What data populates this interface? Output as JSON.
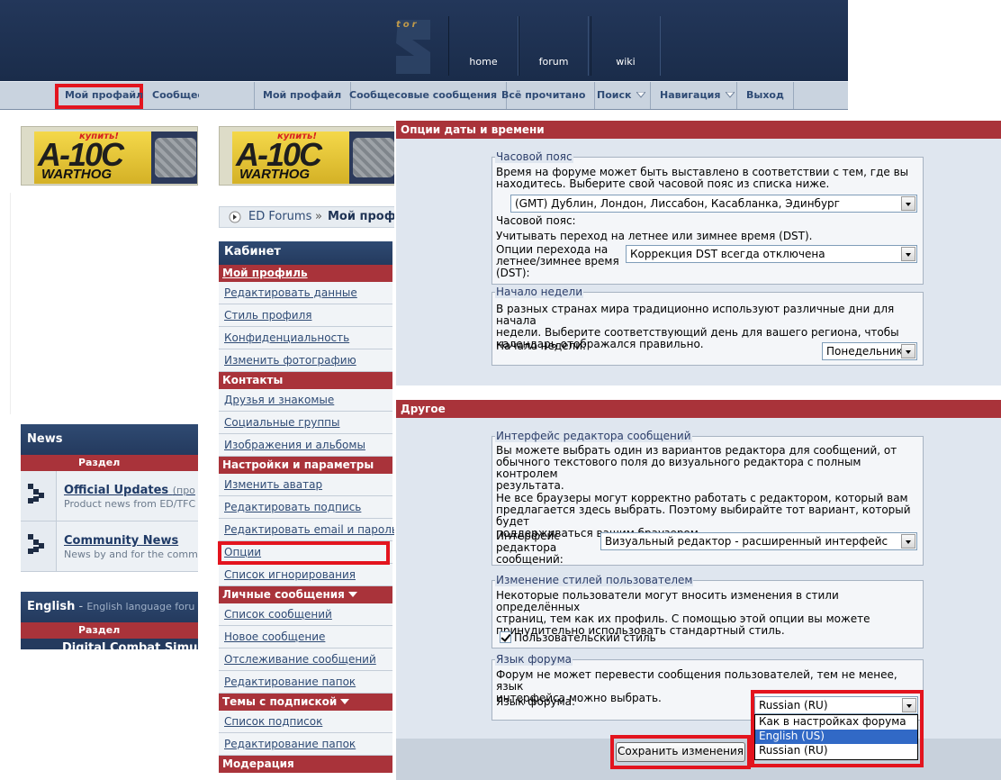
{
  "header": {
    "logo_letters": "tor",
    "tabs": [
      "home",
      "forum",
      "wiki"
    ]
  },
  "navbar_left": {
    "my_profile": "Мой профайл",
    "community": "Сообщес"
  },
  "navbar": {
    "items": [
      "Мой профайл",
      "Сообщесовые сообщения",
      "Всё прочитано",
      "Поиск",
      "Навигация",
      "Выход"
    ]
  },
  "banner": {
    "kupit": "купить!",
    "title": "A-10C",
    "subtitle": "WARTHOG"
  },
  "breadcrumb": {
    "home": "ED Forums",
    "sep": "»",
    "current": "Мой проф"
  },
  "left": {
    "news_header": "News",
    "section_label": "Раздел",
    "forums": [
      {
        "title": "Official Updates",
        "suffix": "(про",
        "desc": "Product news from ED/TFC"
      },
      {
        "title": "Community News",
        "suffix": "",
        "desc": "News by and for the comm"
      }
    ],
    "english_header": "English",
    "english_sep": " - ",
    "english_desc": "English language foru",
    "section_label2": "Раздел",
    "next_forum": "Digital Combat Simul"
  },
  "cabinet": {
    "title": "Кабинет",
    "sections": [
      {
        "title": "Мой профиль",
        "underline": true,
        "dropdown": false,
        "links": [
          "Редактировать данные",
          "Стиль профиля",
          "Конфиденциальность",
          "Изменить фотографию"
        ]
      },
      {
        "title": "Контакты",
        "underline": false,
        "dropdown": false,
        "links": [
          "Друзья и знакомые",
          "Социальные группы",
          "Изображения и альбомы"
        ]
      },
      {
        "title": "Настройки и параметры",
        "underline": false,
        "dropdown": false,
        "links": [
          "Изменить аватар",
          "Редактировать подпись",
          "Редактировать email и пароль",
          "Опции",
          "Список игнорирования"
        ]
      },
      {
        "title": "Личные сообщения",
        "underline": false,
        "dropdown": true,
        "links": [
          "Список сообщений",
          "Новое сообщение",
          "Отслеживание сообщений",
          "Редактирование папок"
        ]
      },
      {
        "title": "Темы с подпиской",
        "underline": false,
        "dropdown": true,
        "links": [
          "Список подписок",
          "Редактирование папок"
        ]
      },
      {
        "title": "Модерация",
        "underline": false,
        "dropdown": false,
        "links": []
      }
    ]
  },
  "datetime": {
    "header": "Опции даты и времени",
    "timezone": {
      "legend": "Часовой пояс",
      "desc1": "Время на форуме может быть выставлено в соответствии с тем, где вы",
      "desc2": "находитесь. Выберите свой часовой пояс из списка ниже.",
      "select_value": "(GMT) Дублин, Лондон, Лиссабон, Касабланка, Эдинбург",
      "label": "Часовой пояс:",
      "dst_desc": "Учитывать переход на летнее или зимнее время (DST).",
      "dst_label1": "Опции перехода на",
      "dst_label2": "летнее/зимнее время",
      "dst_label3": "(DST):",
      "dst_value": "Коррекция DST всегда отключена"
    },
    "week": {
      "legend": "Начало недели",
      "desc1": "В разных странах мира традиционно используют различные дни для начала",
      "desc2": "недели. Выберите соответствующий день для вашего региона, чтобы",
      "desc3": "календарь отображался правильно.",
      "label": "Начало недели:",
      "value": "Понедельник"
    }
  },
  "other": {
    "header": "Другое",
    "editor": {
      "legend": "Интерфейс редактора сообщений",
      "desc1": "Вы можете выбрать один из вариантов редактора для сообщений, от",
      "desc2": "обычного текстового поля до визуального редактора с полным контролем",
      "desc3": "результата.",
      "desc4": "Не все браузеры могут корректно работать с редактором, который вам",
      "desc5": "предлагается здесь выбрать. Поэтому выбирайте тот вариант, который будет",
      "desc6": "поддерживаться вашим браузером.",
      "label1": "Интерфейс",
      "label2": "редактора",
      "label3": "сообщений:",
      "value": "Визуальный редактор - расширенный интерфейс"
    },
    "styles": {
      "legend": "Изменение стилей пользователем",
      "desc1": "Некоторые пользователи могут вносить изменения в стили определённых",
      "desc2": "страниц, тем как их профиль. С помощью этой опции вы можете",
      "desc3": "принудительно использовать стандартный стиль.",
      "checkbox_label": "Пользовательский стиль",
      "checked": true
    },
    "language": {
      "legend": "Язык форума",
      "desc1": "Форум не может перевести сообщения пользователей, тем не менее, язык",
      "desc2": "интерфейса можно выбрать.",
      "label": "Язык форума:",
      "value": "Russian (RU)",
      "options": [
        "Как в настройках форума",
        "English (US)",
        "Russian (RU)"
      ],
      "highlighted": "English (US)"
    },
    "save_button": "Сохранить изменения"
  },
  "colors": {
    "highlight_red": "#e3141e",
    "section_red": "#a9333a",
    "header_navy": "#1f3354"
  }
}
